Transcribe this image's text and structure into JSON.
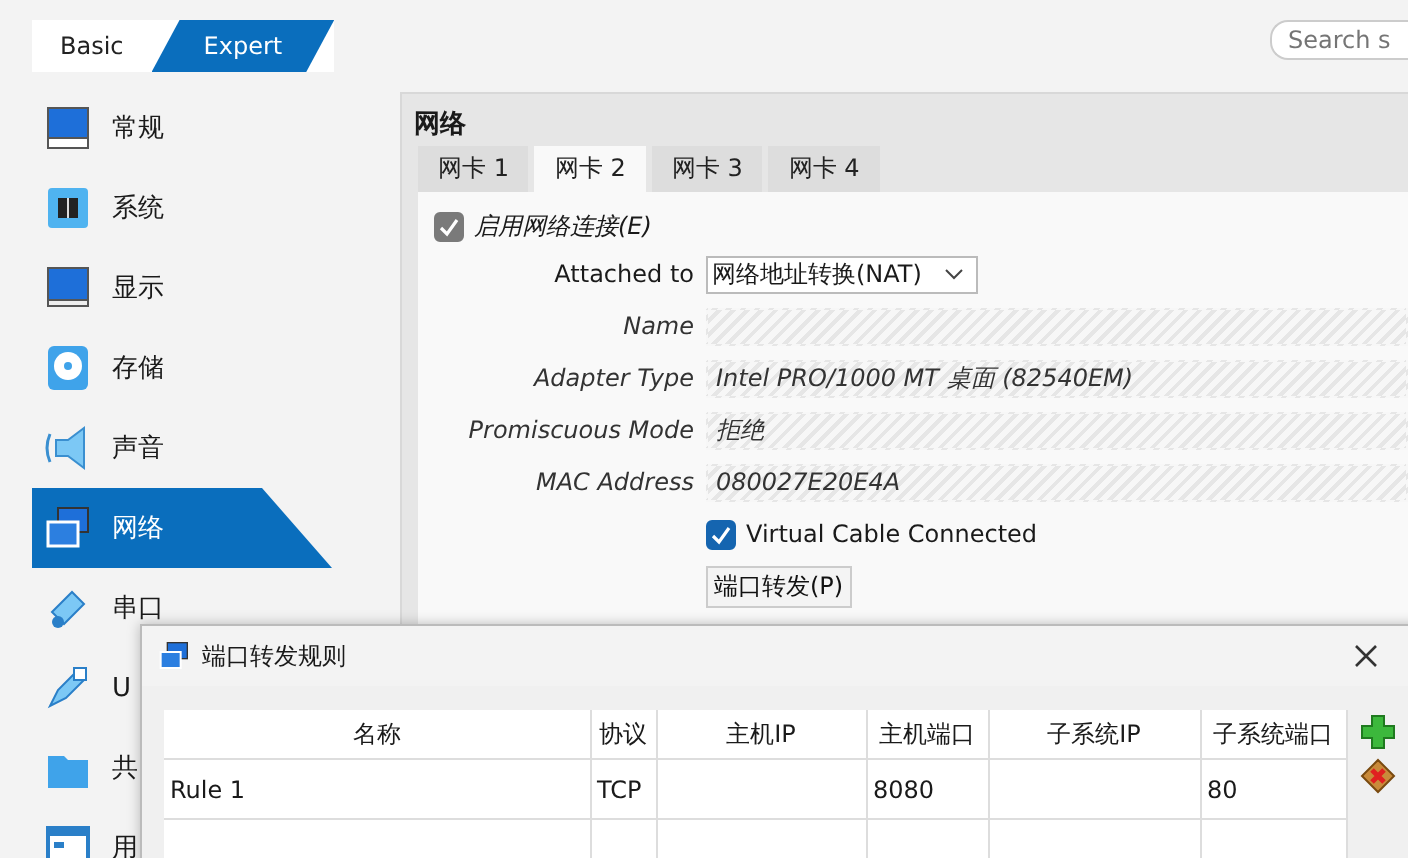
{
  "modes": [
    {
      "label": "Basic",
      "selected": false
    },
    {
      "label": "Expert",
      "selected": true
    }
  ],
  "search": {
    "placeholder": "Search s"
  },
  "sidebar": {
    "items": [
      {
        "label": "常规",
        "selected": false
      },
      {
        "label": "系统",
        "selected": false
      },
      {
        "label": "显示",
        "selected": false
      },
      {
        "label": "存储",
        "selected": false
      },
      {
        "label": "声音",
        "selected": false
      },
      {
        "label": "网络",
        "selected": true
      },
      {
        "label": "串口",
        "selected": false
      },
      {
        "label": "U",
        "selected": false
      },
      {
        "label": "共",
        "selected": false
      },
      {
        "label": "用",
        "selected": false
      }
    ]
  },
  "section": {
    "title": "网络",
    "tabs": [
      {
        "label": "网卡 1",
        "selected": false
      },
      {
        "label": "网卡 2",
        "selected": true
      },
      {
        "label": "网卡 3",
        "selected": false
      },
      {
        "label": "网卡 4",
        "selected": false
      }
    ],
    "enable": {
      "label": "启用网络连接(E)",
      "checked": true,
      "disabled": true
    },
    "fields": [
      {
        "kind": "dropdown",
        "label": "Attached to",
        "value": "网络地址转换(NAT)",
        "disabled": false
      },
      {
        "kind": "text",
        "label": "Name",
        "disabled": true
      },
      {
        "kind": "text",
        "label": "Adapter Type",
        "value": "Intel PRO/1000 MT 桌面 (82540EM)",
        "disabled": true
      },
      {
        "kind": "text",
        "label": "Promiscuous Mode",
        "value": "拒绝",
        "disabled": true
      },
      {
        "kind": "text",
        "label": "MAC Address",
        "value": "080027E20E4A",
        "disabled": true
      }
    ],
    "cable": {
      "label": "Virtual Cable Connected",
      "checked": true
    },
    "port_forward_button": "端口转发(P)"
  },
  "dialog": {
    "title": "端口转发规则",
    "columns": [
      "名称",
      "协议",
      "主机IP",
      "主机端口",
      "子系统IP",
      "子系统端口"
    ],
    "rows": [
      {
        "cells": [
          "Rule 1",
          "TCP",
          null,
          "8080",
          null,
          "80"
        ]
      }
    ]
  }
}
